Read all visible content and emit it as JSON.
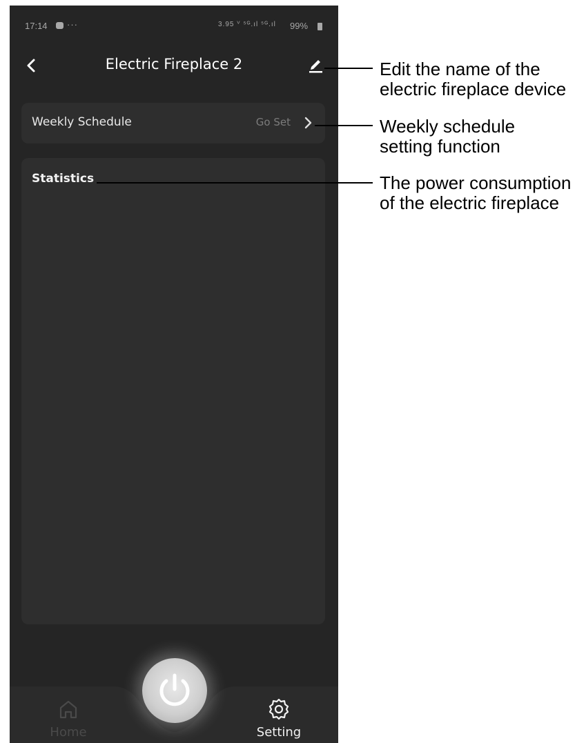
{
  "status_bar": {
    "time": "17:14",
    "dots": "···",
    "indicators": "3.95 ⱽ ⁵ᴳ.ıl ⁵ᴳ.ıl",
    "battery": "99%"
  },
  "header": {
    "title": "Electric Fireplace 2"
  },
  "schedule": {
    "label": "Weekly Schedule",
    "action": "Go Set"
  },
  "statistics": {
    "label": "Statistics"
  },
  "bottom_nav": {
    "home_label": "Home",
    "setting_label": "Setting"
  },
  "annotations": {
    "edit_line1": "Edit the name of the",
    "edit_line2": "electric fireplace device",
    "schedule_line1": "Weekly schedule",
    "schedule_line2": "setting function",
    "stats_line1": "The power consumption",
    "stats_line2": "of the electric fireplace"
  },
  "colors": {
    "background": "#252525",
    "card": "#2e2e2e",
    "text_primary": "#ffffff",
    "text_muted": "#7c7c7c"
  }
}
